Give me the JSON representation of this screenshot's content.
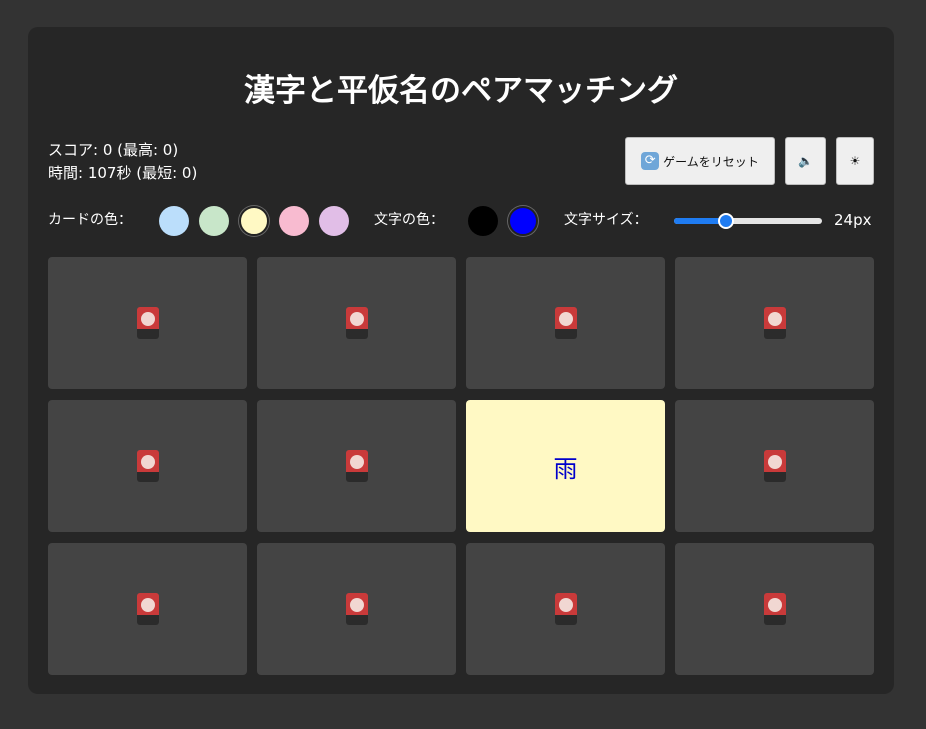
{
  "title": "漢字と平仮名のペアマッチング",
  "stats": {
    "score_line": "スコア: 0 (最高: 0)",
    "time_line": "時間: 107秒 (最短: 0)"
  },
  "toolbar": {
    "reset_label": "ゲームをリセット",
    "reset_icon": "🔄",
    "sound_icon": "🔈",
    "theme_icon": "☀"
  },
  "controls": {
    "card_color_label": "カードの色：",
    "card_colors": [
      "#bbdefb",
      "#c8e6c9",
      "#fff9c4",
      "#f8bbd0",
      "#e1bee7"
    ],
    "card_color_selected": 2,
    "text_color_label": "文字の色：",
    "text_colors": [
      "#000000",
      "#0000ff"
    ],
    "text_color_selected": 1,
    "font_size_label": "文字サイズ：",
    "font_size_value": "24px",
    "font_size_fraction": 0.35
  },
  "cards": [
    {
      "face": "",
      "flipped": false
    },
    {
      "face": "",
      "flipped": false
    },
    {
      "face": "",
      "flipped": false
    },
    {
      "face": "",
      "flipped": false
    },
    {
      "face": "",
      "flipped": false
    },
    {
      "face": "",
      "flipped": false
    },
    {
      "face": "雨",
      "flipped": true
    },
    {
      "face": "",
      "flipped": false
    },
    {
      "face": "",
      "flipped": false
    },
    {
      "face": "",
      "flipped": false
    },
    {
      "face": "",
      "flipped": false
    },
    {
      "face": "",
      "flipped": false
    }
  ],
  "colors": {
    "background": "#333333",
    "panel": "#262626",
    "card_back": "#444444",
    "card_front": "#fff9c4",
    "card_text": "#0000cc",
    "accent": "#1f7cf2"
  }
}
